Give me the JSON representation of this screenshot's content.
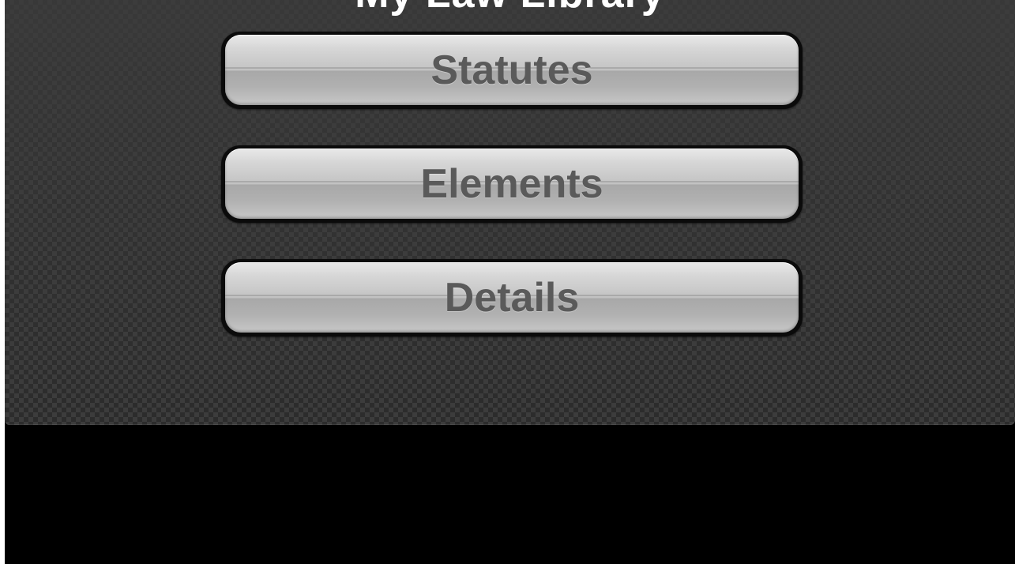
{
  "header": {
    "title": "My Law Library"
  },
  "menu": {
    "buttons": [
      {
        "label": "Statutes"
      },
      {
        "label": "Elements"
      },
      {
        "label": "Details"
      }
    ]
  },
  "colors": {
    "background_carbon": "#2e2e2e",
    "button_text": "#5a5a5a",
    "button_border": "#0b0b0b",
    "lower_area": "#000000"
  }
}
